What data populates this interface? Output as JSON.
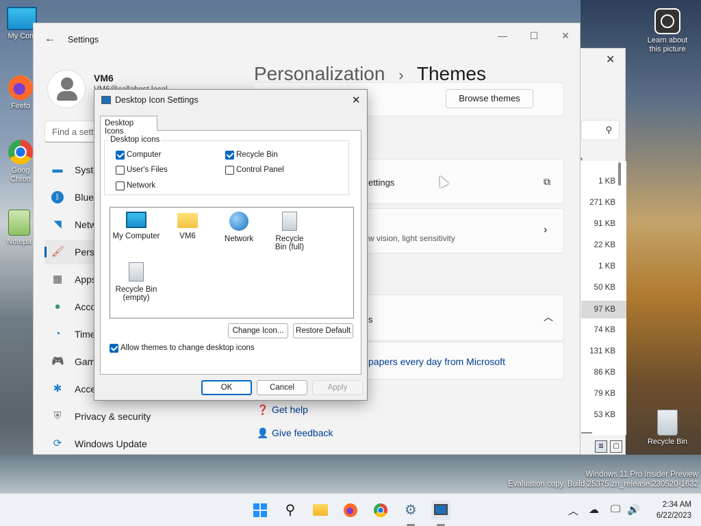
{
  "desktop": {
    "icons": [
      {
        "label": "My Com"
      },
      {
        "label": "Firefo"
      },
      {
        "label": "Goog Chron"
      },
      {
        "label": "Notepa"
      },
      {
        "label": "Recycle Bin"
      }
    ],
    "learn": {
      "label": "Learn about this picture"
    },
    "watermark_line1": "Windows 11 Pro Insider Preview",
    "watermark_line2": "Evaluation copy. Build 25375.zn_release.230520-1632"
  },
  "explorer_bg": {
    "col_header": "e",
    "sizes": [
      "1 KB",
      "271 KB",
      "91 KB",
      "22 KB",
      "1 KB",
      "50 KB",
      "97 KB",
      "74 KB",
      "131 KB",
      "86 KB",
      "79 KB",
      "53 KB"
    ]
  },
  "settings": {
    "app_title": "Settings",
    "user_name": "VM6",
    "user_email": "VM6@callahost.local",
    "find_placeholder": "Find a sett",
    "nav": [
      {
        "label": "Syste",
        "icon": "system-icon"
      },
      {
        "label": "Blueto",
        "icon": "bluetooth-icon"
      },
      {
        "label": "Netw",
        "icon": "network-icon"
      },
      {
        "label": "Perso",
        "icon": "brush-icon"
      },
      {
        "label": "Apps",
        "icon": "apps-icon"
      },
      {
        "label": "Acco",
        "icon": "account-icon"
      },
      {
        "label": "Time",
        "icon": "time-icon"
      },
      {
        "label": "Gam",
        "icon": "gamepad-icon"
      },
      {
        "label": "Acce",
        "icon": "accessibility-icon"
      },
      {
        "label": "Privacy & security",
        "icon": "shield-icon"
      },
      {
        "label": "Windows Update",
        "icon": "update-icon"
      }
    ],
    "breadcrumb_parent": "Personalization",
    "breadcrumb_sep": "›",
    "breadcrumb_current": "Themes",
    "browse_themes": "Browse themes",
    "row_settings": "ettings",
    "row_contrast": "w vision, light sensitivity",
    "row_papers": "papers every day from Microsoft",
    "row_s": "s",
    "get_help": "Get help",
    "give_feedback": "Give feedback"
  },
  "dialog": {
    "title": "Desktop Icon Settings",
    "tab": "Desktop Icons",
    "group_title": "Desktop icons",
    "checkboxes": [
      {
        "label": "Computer",
        "checked": true
      },
      {
        "label": "Recycle Bin",
        "checked": true
      },
      {
        "label": "User's Files",
        "checked": false
      },
      {
        "label": "Control Panel",
        "checked": false
      },
      {
        "label": "Network",
        "checked": false
      }
    ],
    "items": [
      {
        "label": "My Computer"
      },
      {
        "label": "VM6"
      },
      {
        "label": "Network"
      },
      {
        "label": "Recycle Bin (full)"
      },
      {
        "label": "Recycle Bin (empty)"
      }
    ],
    "change_icon": "Change Icon...",
    "restore_default": "Restore Default",
    "allow_themes": "Allow themes to change desktop icons",
    "allow_checked": true,
    "ok": "OK",
    "cancel": "Cancel",
    "apply": "Apply"
  },
  "taskbar": {
    "time": "2:34 AM",
    "date": "6/22/2023"
  }
}
